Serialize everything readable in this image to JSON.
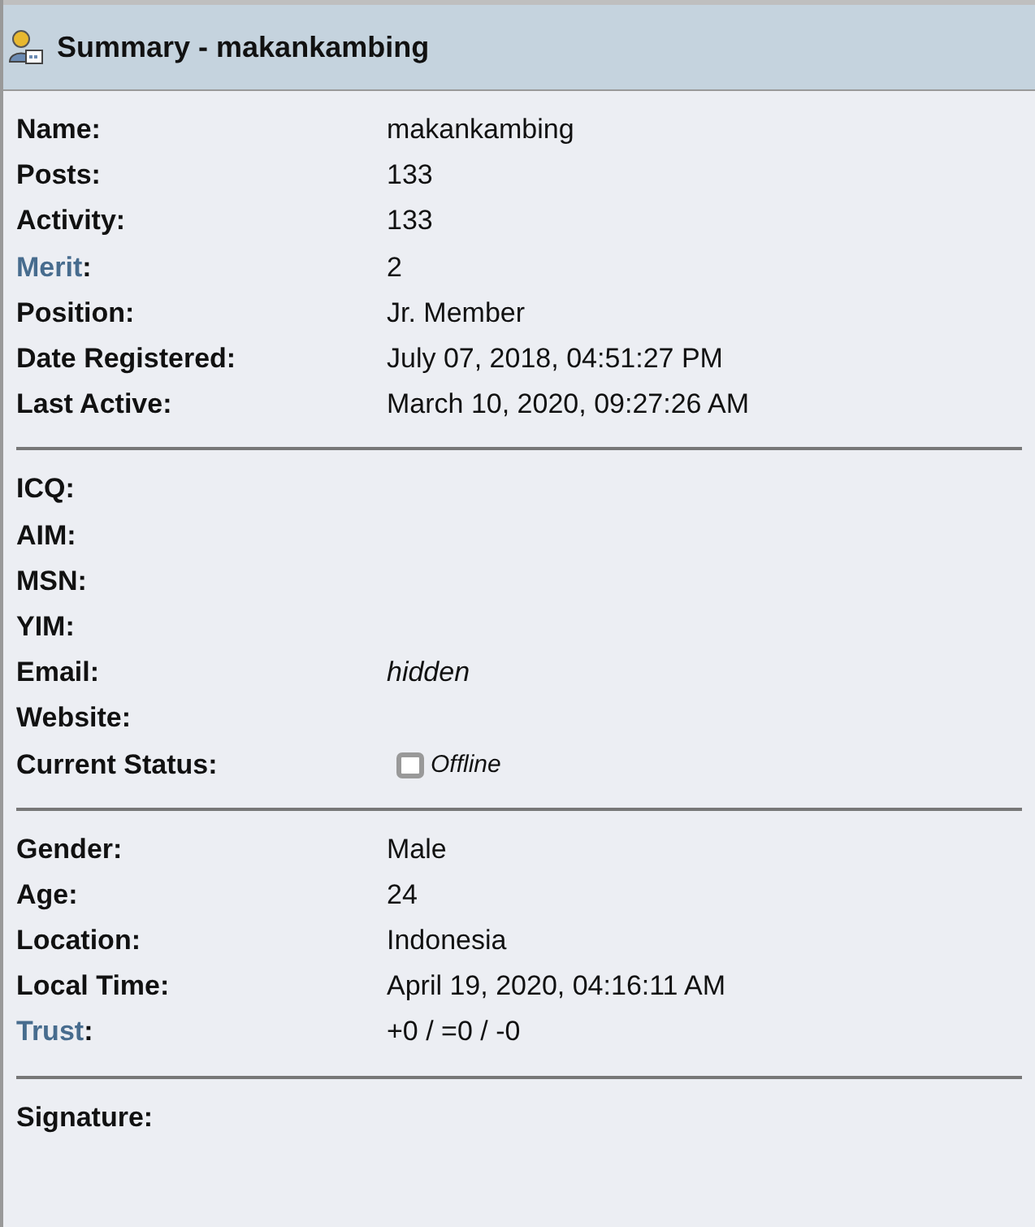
{
  "header": {
    "title": "Summary - makankambing"
  },
  "sections": [
    {
      "rows": [
        {
          "label": "Name:",
          "kind": "text",
          "value": "makankambing"
        },
        {
          "label": "Posts:",
          "kind": "text",
          "value": "133"
        },
        {
          "label": "Activity:",
          "kind": "text",
          "value": "133"
        },
        {
          "link": "Merit",
          "label": ":",
          "kind": "text",
          "value": "2"
        },
        {
          "label": "Position:",
          "kind": "text",
          "value": "Jr. Member"
        },
        {
          "label": "Date Registered:",
          "kind": "text",
          "value": "July 07, 2018, 04:51:27 PM"
        },
        {
          "label": "Last Active:",
          "kind": "text",
          "value": "March 10, 2020, 09:27:26 AM"
        }
      ]
    },
    {
      "rows": [
        {
          "label": "ICQ:"
        },
        {
          "label": "AIM:"
        },
        {
          "label": "MSN:"
        },
        {
          "label": "YIM:"
        },
        {
          "label": "Email:",
          "kind": "italic",
          "value": "hidden"
        },
        {
          "label": "Website:"
        },
        {
          "label": "Current Status:",
          "kind": "status",
          "value": "Offline"
        }
      ]
    },
    {
      "rows": [
        {
          "label": "Gender:",
          "kind": "text",
          "value": "Male"
        },
        {
          "label": "Age:",
          "kind": "text",
          "value": "24"
        },
        {
          "label": "Location:",
          "kind": "text",
          "value": "Indonesia"
        },
        {
          "label": "Local Time:",
          "kind": "text",
          "value": "April 19, 2020, 04:16:11 AM"
        },
        {
          "link": "Trust",
          "label": ":",
          "kind": "text",
          "value": "+0 / =0 / -0"
        }
      ]
    },
    {
      "rows": [
        {
          "label": "Signature:"
        }
      ]
    }
  ]
}
